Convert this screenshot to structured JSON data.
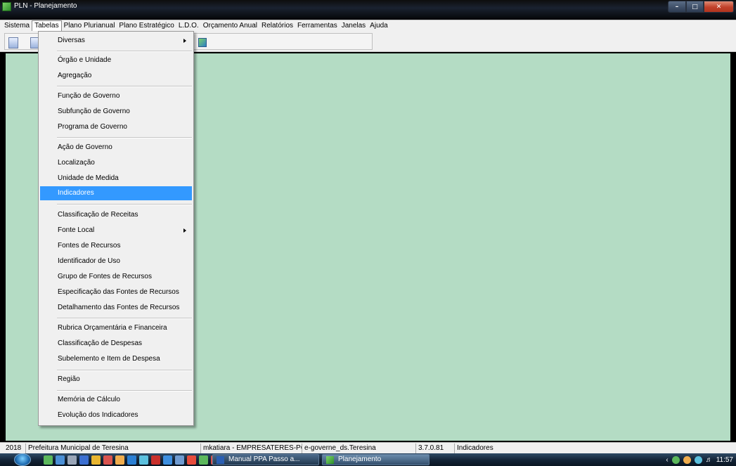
{
  "window": {
    "title": "PLN - Planejamento"
  },
  "menubar": [
    "Sistema",
    "Tabelas",
    "Plano Plurianual",
    "Plano Estratégico",
    "L.D.O.",
    "Orçamento Anual",
    "Relatórios",
    "Ferramentas",
    "Janelas",
    "Ajuda"
  ],
  "active_menu": "Tabelas",
  "tabelas_menu": {
    "diversas": "Diversas",
    "orgao_unidade": "Órgão e Unidade",
    "agregacao": "Agregação",
    "funcao_governo": "Função de Governo",
    "subfuncao_governo": "Subfunção de Governo",
    "programa_governo": "Programa de Governo",
    "acao_governo": "Ação de Governo",
    "localizacao": "Localização",
    "unidade_medida": "Unidade de Medida",
    "indicadores": "Indicadores",
    "classificacao_receitas": "Classificação de Receitas",
    "fonte_local": "Fonte Local",
    "fontes_recursos": "Fontes de Recursos",
    "identificador_uso": "Identificador de Uso",
    "grupo_fontes": "Grupo de Fontes de Recursos",
    "especificacao_fontes": "Especificação das Fontes de Recursos",
    "detalhamento_fontes": "Detalhamento das Fontes de Recursos",
    "rubrica": "Rubrica Orçamentária e Financeira",
    "classificacao_despesas": "Classificação de Despesas",
    "subelemento": "Subelemento e Item de Despesa",
    "regiao": "Região",
    "memoria_calculo": "Memória de Cálculo",
    "evolucao_indicadores": "Evolução dos Indicadores",
    "selected": "Indicadores"
  },
  "statusbar": {
    "year": "2018",
    "entity": "Prefeitura Municipal de Teresina",
    "user": "mkatiara - EMPRESATERES-PC",
    "database": "e-governe_ds.Teresina",
    "version": "3.7.0.81",
    "current": "Indicadores"
  },
  "taskbar": {
    "tasks": [
      "Manual PPA Passo a...",
      "Planejamento"
    ],
    "clock": "11:57"
  },
  "colors": {
    "workspace": "#b4dcc4",
    "selection": "#3399ff"
  }
}
